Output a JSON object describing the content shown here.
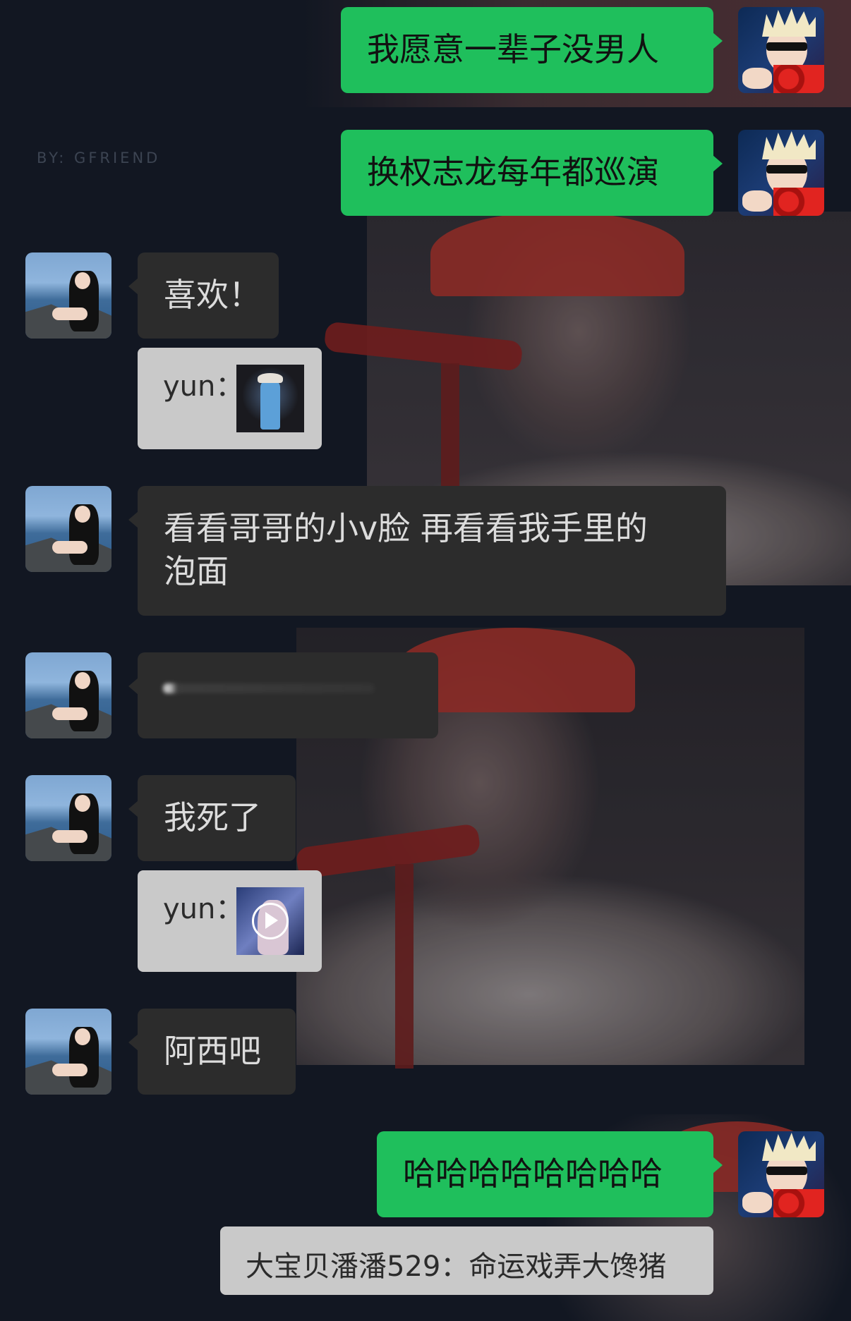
{
  "watermark": "BY: GFRIEND",
  "messages": [
    {
      "id": "m1",
      "sender": "self",
      "text": "我愿意一辈子没男人"
    },
    {
      "id": "m2",
      "sender": "self",
      "text": "换权志龙每年都巡演"
    },
    {
      "id": "m3",
      "sender": "other",
      "text": "喜欢！"
    },
    {
      "id": "m4",
      "sender": "other",
      "type": "quote",
      "text": "yun："
    },
    {
      "id": "m5",
      "sender": "other",
      "text_lines": [
        "看看哥哥的小v脸 再看看我手里的",
        "泡面"
      ]
    },
    {
      "id": "m6",
      "sender": "other",
      "type": "blurred"
    },
    {
      "id": "m7",
      "sender": "other",
      "text": "我死了"
    },
    {
      "id": "m8",
      "sender": "other",
      "type": "quote-video",
      "text": "yun："
    },
    {
      "id": "m9",
      "sender": "other",
      "text": "阿西吧"
    },
    {
      "id": "m10",
      "sender": "self",
      "text": "哈哈哈哈哈哈哈哈"
    },
    {
      "id": "m11",
      "sender": "self",
      "type": "quote",
      "text": "大宝贝潘潘529：命运戏弄大馋猪"
    }
  ],
  "colors": {
    "background": "#121722",
    "self_bubble": "#1fbf5c",
    "other_bubble": "#2c2c2c",
    "quote_bubble": "#c9c9c9"
  },
  "icons": {
    "video_play": "play-circle-icon"
  }
}
